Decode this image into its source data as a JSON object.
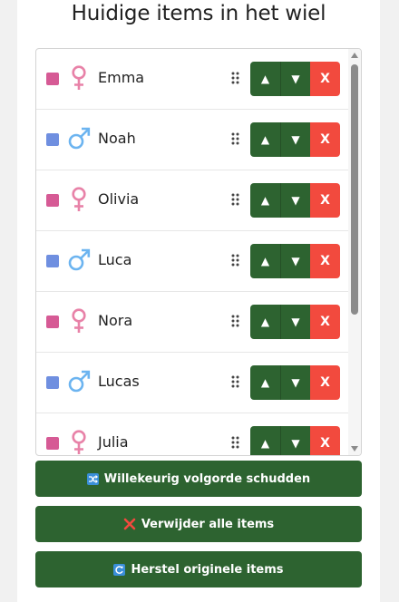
{
  "title": "Huidige items in het wiel",
  "colors": {
    "female_swatch": "#d65a95",
    "male_swatch": "#6f8fe0",
    "female_symbol": "#e882a8",
    "male_symbol": "#6cb4f0",
    "button_green": "#2d6330",
    "button_red": "#f24a3e"
  },
  "items": [
    {
      "name": "Emma",
      "gender": "female",
      "gender_icon": "female-symbol-icon"
    },
    {
      "name": "Noah",
      "gender": "male",
      "gender_icon": "male-symbol-icon"
    },
    {
      "name": "Olivia",
      "gender": "female",
      "gender_icon": "female-symbol-icon"
    },
    {
      "name": "Luca",
      "gender": "male",
      "gender_icon": "male-symbol-icon"
    },
    {
      "name": "Nora",
      "gender": "female",
      "gender_icon": "female-symbol-icon"
    },
    {
      "name": "Lucas",
      "gender": "male",
      "gender_icon": "male-symbol-icon"
    },
    {
      "name": "Julia",
      "gender": "female",
      "gender_icon": "female-symbol-icon"
    }
  ],
  "item_buttons": {
    "up_label": "▲",
    "down_label": "▼",
    "delete_label": "X"
  },
  "actions": {
    "shuffle_label": "Willekeurig volgorde schudden",
    "shuffle_icon": "shuffle-icon",
    "delete_all_label": "Verwijder alle items",
    "delete_all_icon": "cross-mark-icon",
    "restore_label": "Herstel originele items",
    "restore_icon": "refresh-icon"
  }
}
